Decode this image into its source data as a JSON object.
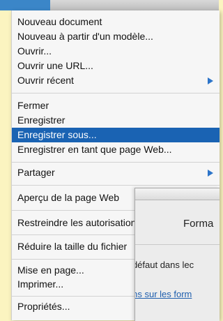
{
  "menu": {
    "items": [
      {
        "label": "Nouveau document"
      },
      {
        "label": "Nouveau à partir d'un modèle..."
      },
      {
        "label": "Ouvrir..."
      },
      {
        "label": "Ouvrir une URL..."
      },
      {
        "label": "Ouvrir récent"
      },
      {
        "label": "Fermer"
      },
      {
        "label": "Enregistrer"
      },
      {
        "label": "Enregistrer sous..."
      },
      {
        "label": "Enregistrer en tant que page Web..."
      },
      {
        "label": "Partager"
      },
      {
        "label": "Aperçu de la page Web"
      },
      {
        "label": "Restreindre les autorisations"
      },
      {
        "label": "Réduire la taille du fichier"
      },
      {
        "label": "Mise en page..."
      },
      {
        "label": "Imprimer..."
      },
      {
        "label": "Propriétés..."
      }
    ],
    "selected_item": "Enregistrer sous..."
  },
  "dialog": {
    "title": "Forma",
    "text": "r défaut dans lec",
    "link": "ions sur les form"
  },
  "colors": {
    "selection": "#1a63b3",
    "submenu_arrow": "#2c74c9",
    "link": "#1f5fae",
    "background": "#fbf4c0"
  },
  "icons": {
    "submenu": "chevron-right-icon"
  }
}
